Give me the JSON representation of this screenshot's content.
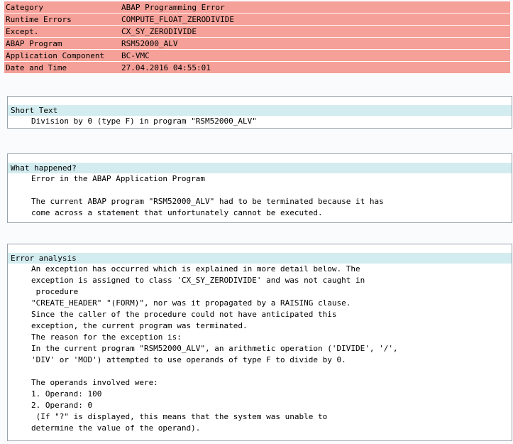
{
  "header": {
    "rows": [
      {
        "label": "Category",
        "value": "ABAP Programming Error"
      },
      {
        "label": "Runtime Errors",
        "value": "COMPUTE_FLOAT_ZERODIVIDE"
      },
      {
        "label": "Except.",
        "value": "CX_SY_ZERODIVIDE"
      },
      {
        "label": "ABAP Program",
        "value": "RSM52000_ALV"
      },
      {
        "label": "Application Component",
        "value": "BC-VMC"
      },
      {
        "label": "Date and Time",
        "value": "27.04.2016 04:55:01"
      }
    ],
    "bg_color": "#f5a098"
  },
  "short_text": {
    "title": "Short Text",
    "lines": [
      "Division by 0 (type F) in program \"RSM52000_ALV\""
    ]
  },
  "what_happened": {
    "title": "What happened?",
    "lines": [
      "Error in the ABAP Application Program",
      "",
      "The current ABAP program \"RSM52000_ALV\" had to be terminated because it has",
      "come across a statement that unfortunately cannot be executed."
    ]
  },
  "error_analysis": {
    "title": "Error analysis",
    "lines": [
      "An exception has occurred which is explained in more detail below. The",
      "exception is assigned to class 'CX_SY_ZERODIVIDE' and was not caught in",
      " procedure",
      "\"CREATE_HEADER\" \"(FORM)\", nor was it propagated by a RAISING clause.",
      "Since the caller of the procedure could not have anticipated this",
      "exception, the current program was terminated.",
      "The reason for the exception is:",
      "In the current program \"RSM52000_ALV\", an arithmetic operation ('DIVIDE', '/',",
      "'DIV' or 'MOD') attempted to use operands of type F to divide by 0.",
      "",
      "The operands involved were:",
      "1. Operand: 100",
      "2. Operand: 0",
      " (If \"?\" is displayed, this means that the system was unable to",
      "determine the value of the operand)."
    ]
  },
  "colors": {
    "section_title_bg": "#d3ecef",
    "section_border": "#9aa3ab"
  }
}
